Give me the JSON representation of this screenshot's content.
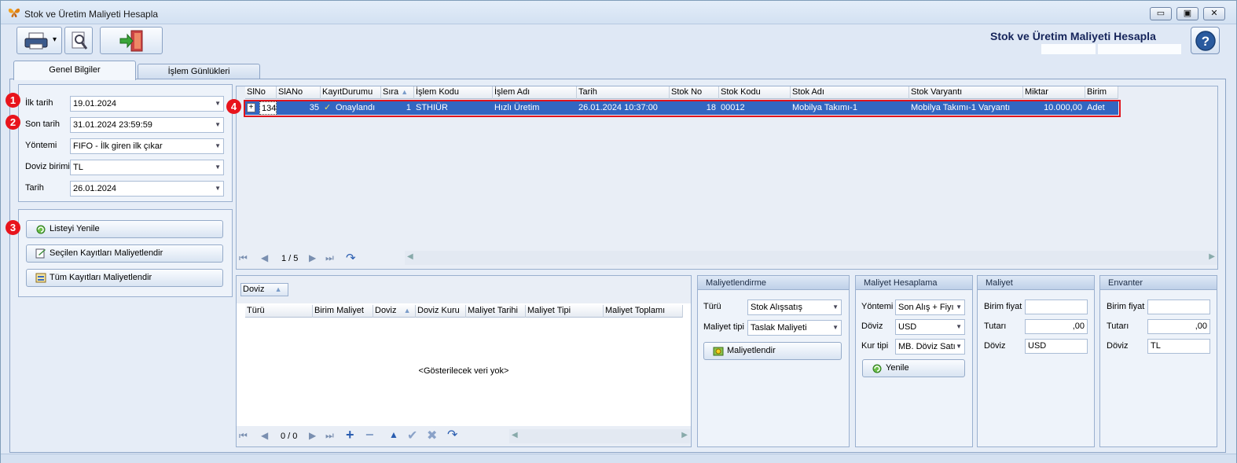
{
  "window": {
    "title": "Stok ve Üretim Maliyeti Hesapla",
    "header_title": "Stok ve Üretim Maliyeti Hesapla",
    "minimize_glyph": "▭",
    "maximize_glyph": "▣",
    "close_glyph": "✕"
  },
  "toolbar": {
    "print_icon": "printer-icon",
    "preview_icon": "print-preview-icon",
    "exit_icon": "exit-door-icon",
    "dropdown_glyph": "▾"
  },
  "tabs": [
    {
      "label": "Genel Bilgiler"
    },
    {
      "label": "İşlem Günlükleri"
    }
  ],
  "filters": {
    "ilk_tarih": {
      "label": "İlk tarih",
      "value": "19.01.2024"
    },
    "son_tarih": {
      "label": "Son tarih",
      "value": "31.01.2024 23:59:59"
    },
    "yontemi": {
      "label": "Yöntemi",
      "value": "FIFO - İlk giren ilk çıkar"
    },
    "doviz_birimi": {
      "label": "Doviz birimi",
      "value": "TL"
    },
    "tarih": {
      "label": "Tarih",
      "value": "26.01.2024"
    }
  },
  "actions": {
    "refresh": "Listeyi Yenile",
    "cost_selected": "Seçilen Kayıtları Maliyetlendir",
    "cost_all": "Tüm Kayıtları Maliyetlendir"
  },
  "badges": [
    "1",
    "2",
    "3",
    "4"
  ],
  "main_grid": {
    "columns": [
      "SlNo",
      "SlANo",
      "KayıtDurumu",
      "Sıra",
      "İşlem Kodu",
      "İşlem Adı",
      "Tarih",
      "Stok No",
      "Stok Kodu",
      "Stok Adı",
      "Stok Varyantı",
      "Miktar",
      "Birim"
    ],
    "rows": [
      {
        "expand": "+",
        "slno": "134",
        "slano": "35",
        "durum": "Onaylandı",
        "check": "✓",
        "sira": "1",
        "islem_kodu": "STHIÜR",
        "islem_adi": "Hızlı Üretim",
        "tarih": "26.01.2024 10:37:00",
        "stok_no": "18",
        "stok_kodu": "00012",
        "stok_adi": "Mobilya Takımı-1",
        "varyant": "Mobilya Takımı-1 Varyantı",
        "miktar": "10.000,00",
        "birim": "Adet"
      }
    ],
    "pager": "1 / 5",
    "sort_glyph": "▲"
  },
  "detail_grid": {
    "group_label": "Doviz",
    "columns": [
      "Türü",
      "Birim Maliyet",
      "Doviz",
      "Doviz Kuru",
      "Maliyet Tarihi",
      "Maliyet Tipi",
      "Maliyet Toplamı"
    ],
    "empty_text": "<Gösterilecek veri yok>",
    "pager": "0 / 0"
  },
  "maliyetlendirme": {
    "title": "Maliyetlendirme",
    "turu_label": "Türü",
    "turu_value": "Stok Alışsatış",
    "tipi_label": "Maliyet tipi",
    "tipi_value": "Taslak Maliyeti",
    "button": "Maliyetlendir"
  },
  "hesaplama": {
    "title": "Maliyet Hesaplama",
    "yontemi_label": "Yöntemi",
    "yontemi_value": "Son Alış + Fiyı",
    "doviz_label": "Döviz",
    "doviz_value": "USD",
    "kur_label": "Kur tipi",
    "kur_value": "MB. Döviz Satı",
    "button": "Yenile"
  },
  "maliyet": {
    "title": "Maliyet",
    "birim_label": "Birim fiyat",
    "birim_value": "",
    "tutar_label": "Tutarı",
    "tutar_value": ",00",
    "doviz_label": "Döviz",
    "doviz_value": "USD"
  },
  "envanter": {
    "title": "Envanter",
    "birim_label": "Birim fiyat",
    "birim_value": "",
    "tutar_label": "Tutarı",
    "tutar_value": ",00",
    "doviz_label": "Döviz",
    "doviz_value": "TL"
  }
}
